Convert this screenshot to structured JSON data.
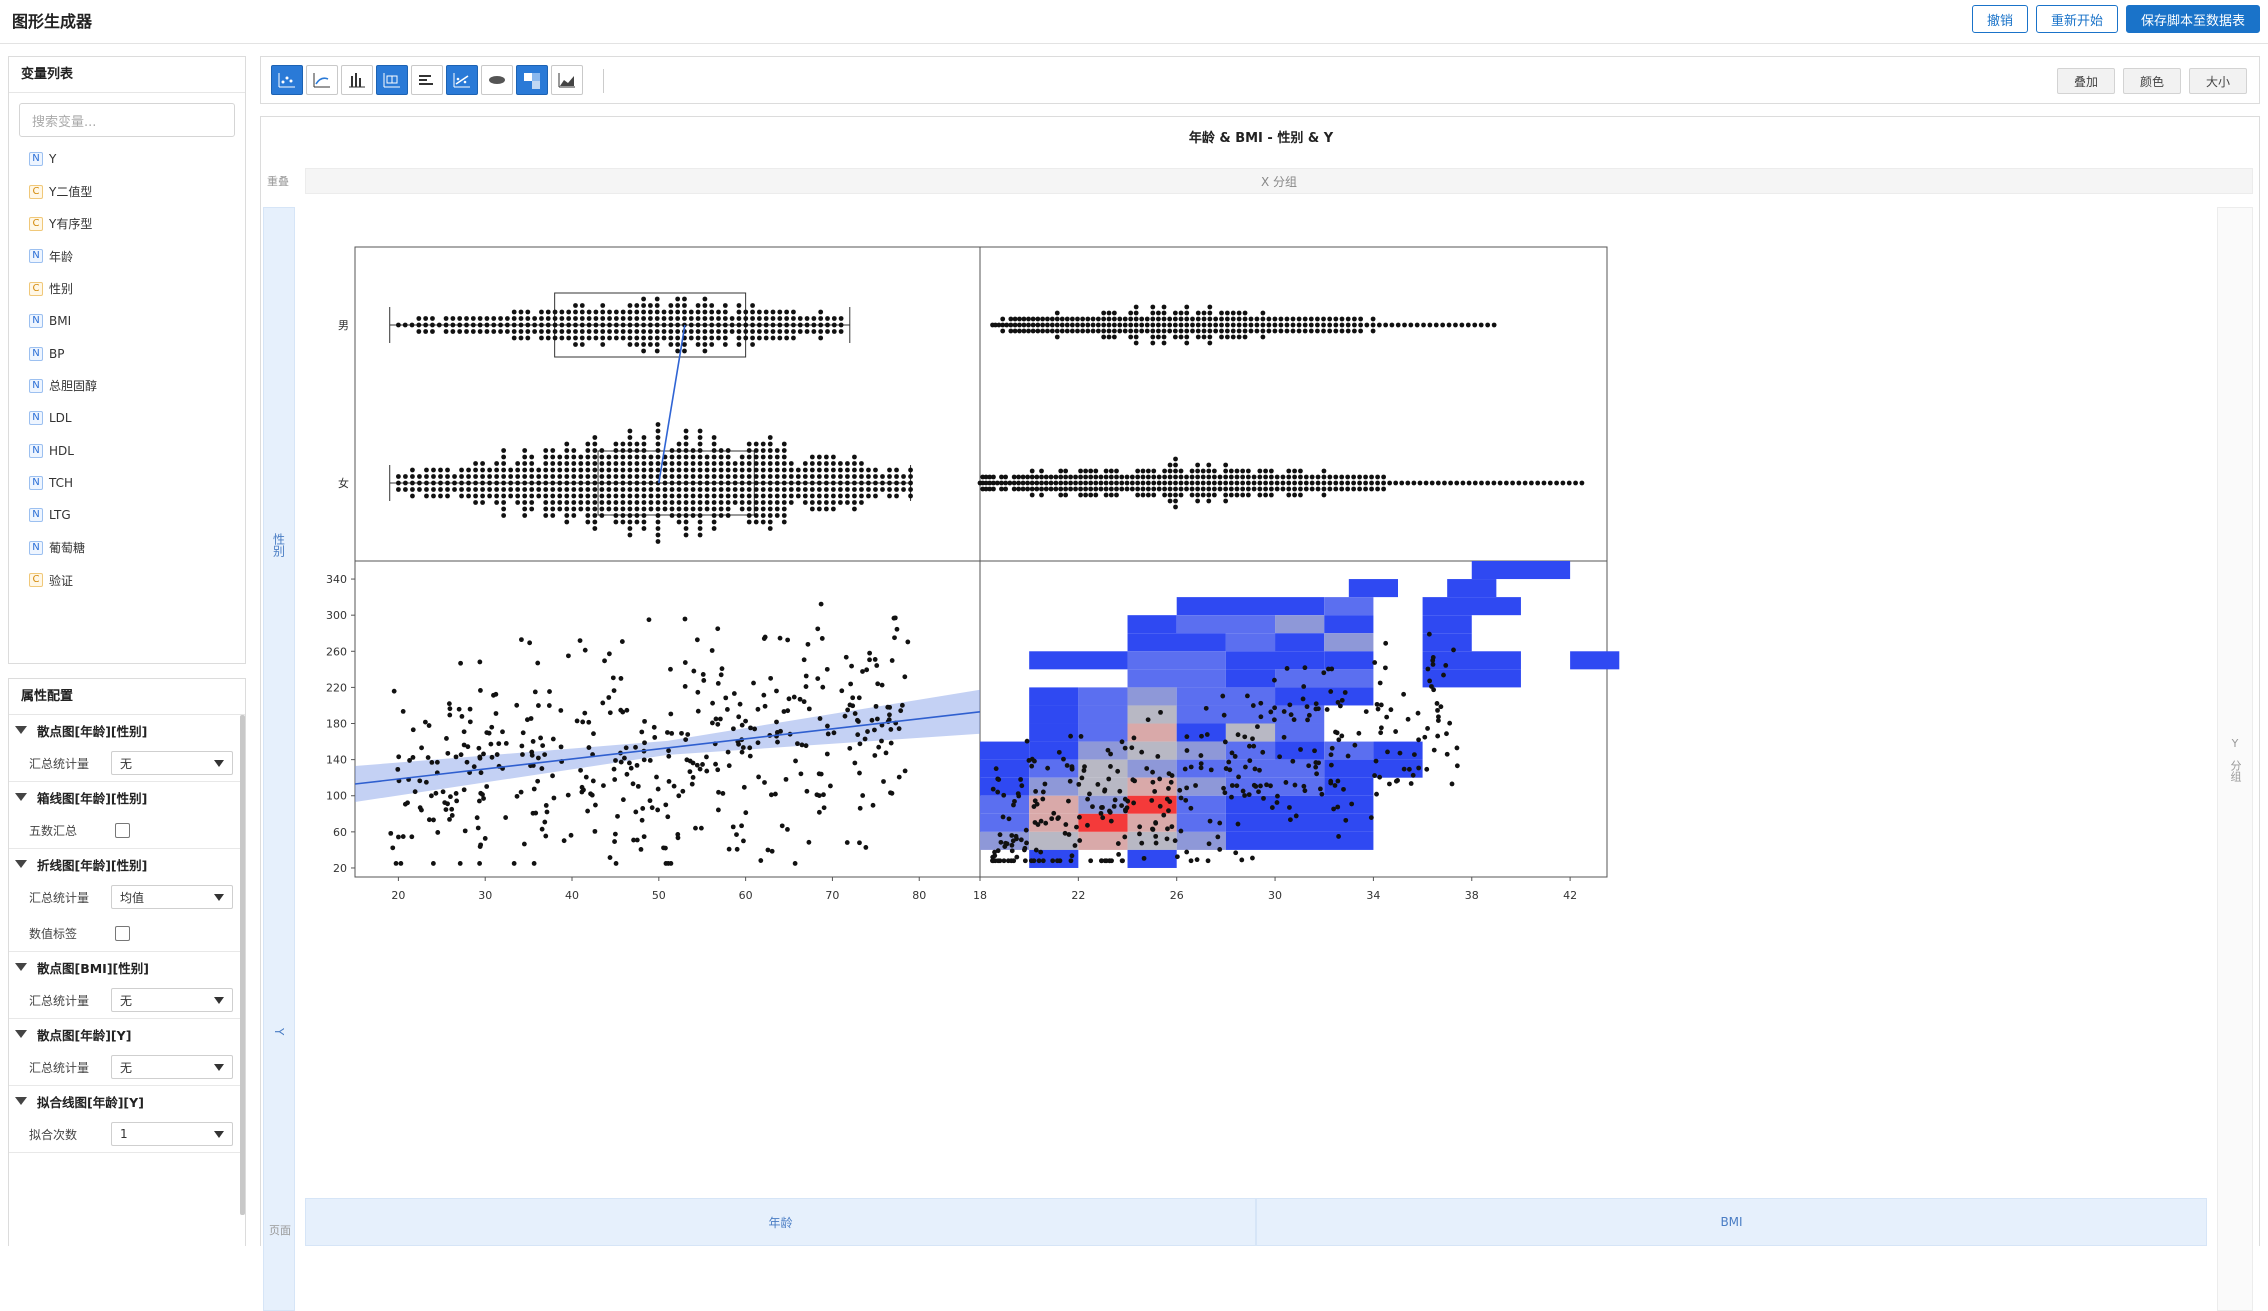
{
  "app": {
    "title": "图形生成器"
  },
  "header": {
    "undo": "撤销",
    "restart": "重新开始",
    "save_script": "保存脚本至数据表"
  },
  "variables": {
    "title": "变量列表",
    "search_placeholder": "搜索变量...",
    "items": [
      {
        "type": "N",
        "name": "Y"
      },
      {
        "type": "C",
        "name": "Y二值型"
      },
      {
        "type": "C",
        "name": "Y有序型"
      },
      {
        "type": "N",
        "name": "年龄"
      },
      {
        "type": "C",
        "name": "性别"
      },
      {
        "type": "N",
        "name": "BMI"
      },
      {
        "type": "N",
        "name": "BP"
      },
      {
        "type": "N",
        "name": "总胆固醇"
      },
      {
        "type": "N",
        "name": "LDL"
      },
      {
        "type": "N",
        "name": "HDL"
      },
      {
        "type": "N",
        "name": "TCH"
      },
      {
        "type": "N",
        "name": "LTG"
      },
      {
        "type": "N",
        "name": "葡萄糖"
      },
      {
        "type": "C",
        "name": "验证"
      }
    ]
  },
  "properties": {
    "title": "属性配置",
    "sections": [
      {
        "title": "散点图[年龄][性别]",
        "rows": [
          {
            "label": "汇总统计量",
            "kind": "select",
            "value": "无"
          }
        ]
      },
      {
        "title": "箱线图[年龄][性别]",
        "rows": [
          {
            "label": "五数汇总",
            "kind": "check"
          }
        ]
      },
      {
        "title": "折线图[年龄][性别]",
        "rows": [
          {
            "label": "汇总统计量",
            "kind": "select",
            "value": "均值"
          },
          {
            "label": "数值标签",
            "kind": "check"
          }
        ]
      },
      {
        "title": "散点图[BMI][性别]",
        "rows": [
          {
            "label": "汇总统计量",
            "kind": "select",
            "value": "无"
          }
        ]
      },
      {
        "title": "散点图[年龄][Y]",
        "rows": [
          {
            "label": "汇总统计量",
            "kind": "select",
            "value": "无"
          }
        ]
      },
      {
        "title": "拟合线图[年龄][Y]",
        "rows": [
          {
            "label": "拟合次数",
            "kind": "select",
            "value": "1"
          }
        ]
      }
    ]
  },
  "toolbar": {
    "icons": [
      "scatter-icon",
      "smoother-icon",
      "points-bar-icon",
      "box-plot-icon",
      "bar-chart-icon",
      "line-fit-icon",
      "ellipse-icon",
      "heatmap-icon",
      "area-chart-icon"
    ],
    "active": [
      true,
      false,
      false,
      true,
      false,
      true,
      false,
      true,
      false
    ],
    "overlay": "叠加",
    "color": "颜色",
    "size": "大小"
  },
  "graph": {
    "title": "年龄 & BMI - 性别 & Y",
    "overlay_label": "重叠",
    "x_group": "X 分组",
    "y_group_top": "Y",
    "y_group_bottom": "分组",
    "page_label": "页面",
    "x_axis_names": [
      "年龄",
      "BMI"
    ],
    "y_axis_names": [
      "性别",
      "Y"
    ]
  },
  "chart_data": [
    {
      "type": "box",
      "title": "",
      "xlabel": "年龄",
      "ylabel": "性别",
      "categories": [
        "男",
        "女"
      ],
      "xlim": [
        15,
        87
      ],
      "boxes": [
        {
          "name": "男",
          "min": 19,
          "q1": 38,
          "median": 53,
          "q3": 60,
          "max": 72
        },
        {
          "name": "女",
          "min": 19,
          "q1": 43,
          "median": 50,
          "q3": 61,
          "max": 79
        }
      ],
      "mean_line": [
        53,
        50
      ]
    },
    {
      "type": "scatter",
      "title": "",
      "xlabel": "BMI",
      "ylabel": "性别",
      "categories": [
        "男",
        "女"
      ],
      "xlim": [
        18,
        43
      ],
      "ranges": [
        {
          "name": "男",
          "min": 18.5,
          "max": 38.5
        },
        {
          "name": "女",
          "min": 18,
          "max": 42
        }
      ]
    },
    {
      "type": "scatter",
      "title": "",
      "xlabel": "年龄",
      "ylabel": "Y",
      "xticks": [
        20,
        30,
        40,
        50,
        60,
        70,
        80
      ],
      "yticks": [
        20,
        60,
        100,
        140,
        180,
        220,
        260,
        300,
        340
      ],
      "xlim": [
        15,
        87
      ],
      "ylim": [
        10,
        360
      ],
      "fit": {
        "x0": 15,
        "y0": 113,
        "x1": 87,
        "y1": 193
      }
    },
    {
      "type": "heatmap",
      "title": "",
      "xlabel": "BMI",
      "ylabel": "Y",
      "xticks": [
        18,
        22,
        26,
        30,
        34,
        38,
        42
      ],
      "yticks": [
        20,
        60,
        100,
        140,
        180,
        220,
        260,
        300,
        340
      ],
      "xlim": [
        18,
        43.5
      ],
      "ylim": [
        10,
        360
      ]
    }
  ]
}
